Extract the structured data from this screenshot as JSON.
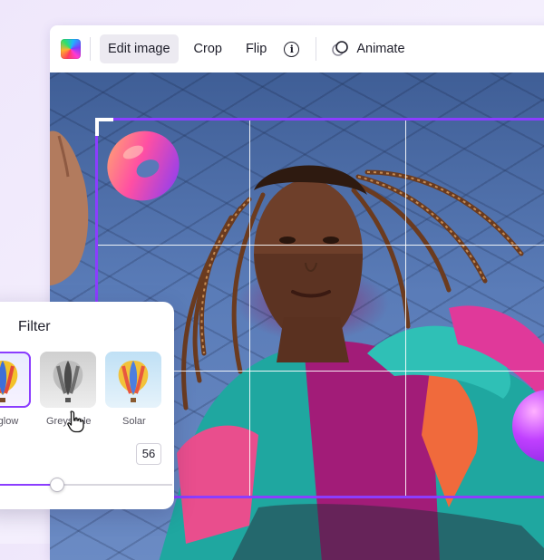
{
  "toolbar": {
    "swatch_icon": "color-swatch-icon",
    "edit_image_label": "Edit image",
    "crop_label": "Crop",
    "flip_label": "Flip",
    "info_glyph": "i",
    "animate_label": "Animate",
    "animate_icon": "animate-icon"
  },
  "colors": {
    "accent": "#8b3dff",
    "toolbar_active_bg": "#eceaf1",
    "text": "#1e1e2a"
  },
  "filter_panel": {
    "title": "Filter",
    "filters": [
      {
        "label": "rglow",
        "selected": true
      },
      {
        "label": "Greyscale",
        "selected": false
      },
      {
        "label": "Solar",
        "selected": false
      }
    ],
    "intensity_value": "56",
    "slider_fraction": 0.39
  },
  "cursor_icon": "pointer-hand-icon"
}
